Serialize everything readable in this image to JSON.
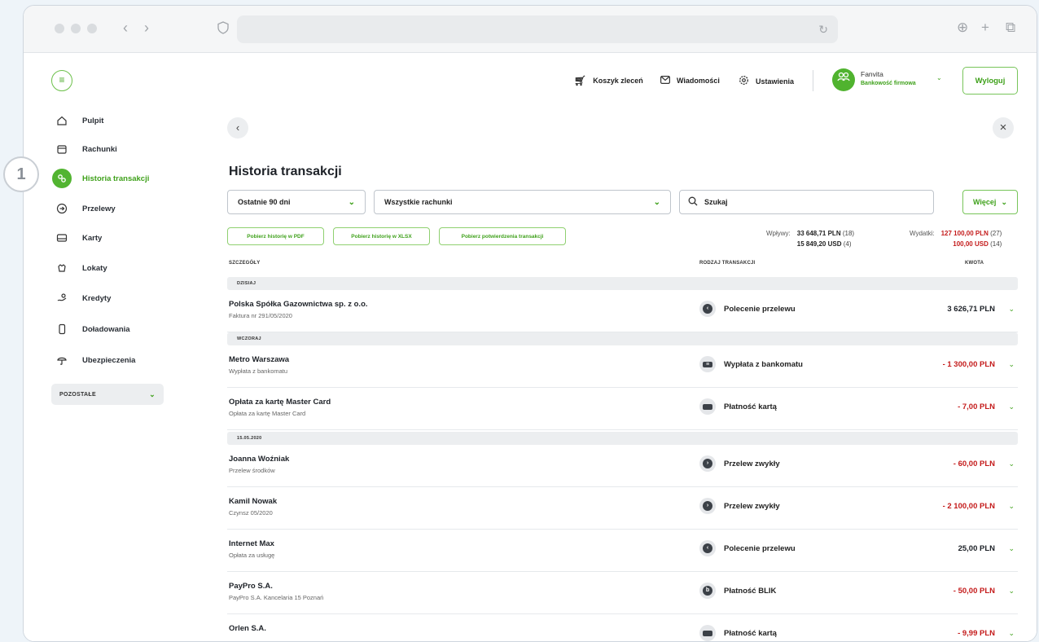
{
  "step_badge": "1",
  "chrome": {
    "back": "‹",
    "forward": "›",
    "reload": "↻",
    "download": "⊕",
    "new_tab": "+",
    "tabs": "⧉"
  },
  "sidebar": {
    "menu_icon": "≡",
    "items": [
      {
        "label": "Pulpit",
        "icon": "home-icon"
      },
      {
        "label": "Rachunki",
        "icon": "wallet-icon"
      },
      {
        "label": "Historia transakcji",
        "icon": "history-icon",
        "active": true
      },
      {
        "label": "Przelewy",
        "icon": "arrow-circle-icon"
      },
      {
        "label": "Karty",
        "icon": "card-icon"
      },
      {
        "label": "Lokaty",
        "icon": "piggy-icon"
      },
      {
        "label": "Kredyty",
        "icon": "loan-icon"
      },
      {
        "label": "Doładowania",
        "icon": "phone-icon"
      },
      {
        "label": "Ubezpieczenia",
        "icon": "umbrella-icon"
      }
    ],
    "other_label": "POZOSTAŁE"
  },
  "header": {
    "cart": "Koszyk zleceń",
    "messages": "Wiadomości",
    "settings": "Ustawienia",
    "user_name": "Fanvita",
    "user_sub": "Bankowość firmowa",
    "logout": "Wyloguj"
  },
  "main": {
    "title": "Historia transakcji",
    "period": "Ostatnie 90 dni",
    "accounts": "Wszystkie rachunki",
    "search_placeholder": "Szukaj",
    "more": "Więcej",
    "download_pdf": "Pobierz historię w PDF",
    "download_xlsx": "Pobierz historię w XLSX",
    "download_conf": "Pobierz potwierdzenia transakcji",
    "income_label": "Wpływy:",
    "income_pln": "33 648,71 PLN",
    "income_pln_count": "(18)",
    "income_usd": "15 849,20 USD",
    "income_usd_count": "(4)",
    "expense_label": "Wydatki:",
    "expense_pln": "127 100,00 PLN",
    "expense_pln_count": "(27)",
    "expense_usd": "100,00 USD",
    "expense_usd_count": "(14)",
    "col_details": "SZCZEGÓŁY",
    "col_type": "RODZAJ TRANSAKCJI",
    "col_amount": "KWOTA"
  },
  "groups": [
    {
      "label": "DZISIAJ"
    },
    {
      "label": "WCZORAJ"
    },
    {
      "label": "15.05.2020"
    }
  ],
  "transactions": [
    {
      "name": "Polska Spółka Gazownictwa sp. z o.o.",
      "desc": "Faktura nr 291/05/2020",
      "type": "Polecenie przelewu",
      "amount": "3 626,71 PLN"
    },
    {
      "name": "Metro Warszawa",
      "desc": "Wypłata z bankomatu",
      "type": "Wypłata z bankomatu",
      "amount": "- 1 300,00 PLN"
    },
    {
      "name": "Opłata za kartę Master Card",
      "desc": "Opłata za kartę Master Card",
      "type": "Płatność kartą",
      "amount": "- 7,00 PLN"
    },
    {
      "name": "Joanna Woźniak",
      "desc": "Przelew środków",
      "type": "Przelew zwykły",
      "amount": "- 60,00 PLN"
    },
    {
      "name": "Kamil Nowak",
      "desc": "Czynsz 05/2020",
      "type": "Przelew zwykły",
      "amount": "- 2 100,00 PLN"
    },
    {
      "name": "Internet Max",
      "desc": "Opłata za usługę",
      "type": "Polecenie przelewu",
      "amount": "25,00 PLN"
    },
    {
      "name": "PayPro S.A.",
      "desc": "PayPro S.A. Kancelaria 15 Poznań",
      "type": "Płatność BLIK",
      "amount": "- 50,00 PLN"
    },
    {
      "name": "Orlen S.A.",
      "desc": "",
      "type": "Płatność kartą",
      "amount": "- 9,99 PLN"
    }
  ],
  "colors": {
    "accent": "#52b431",
    "negative": "#c41b1b"
  }
}
